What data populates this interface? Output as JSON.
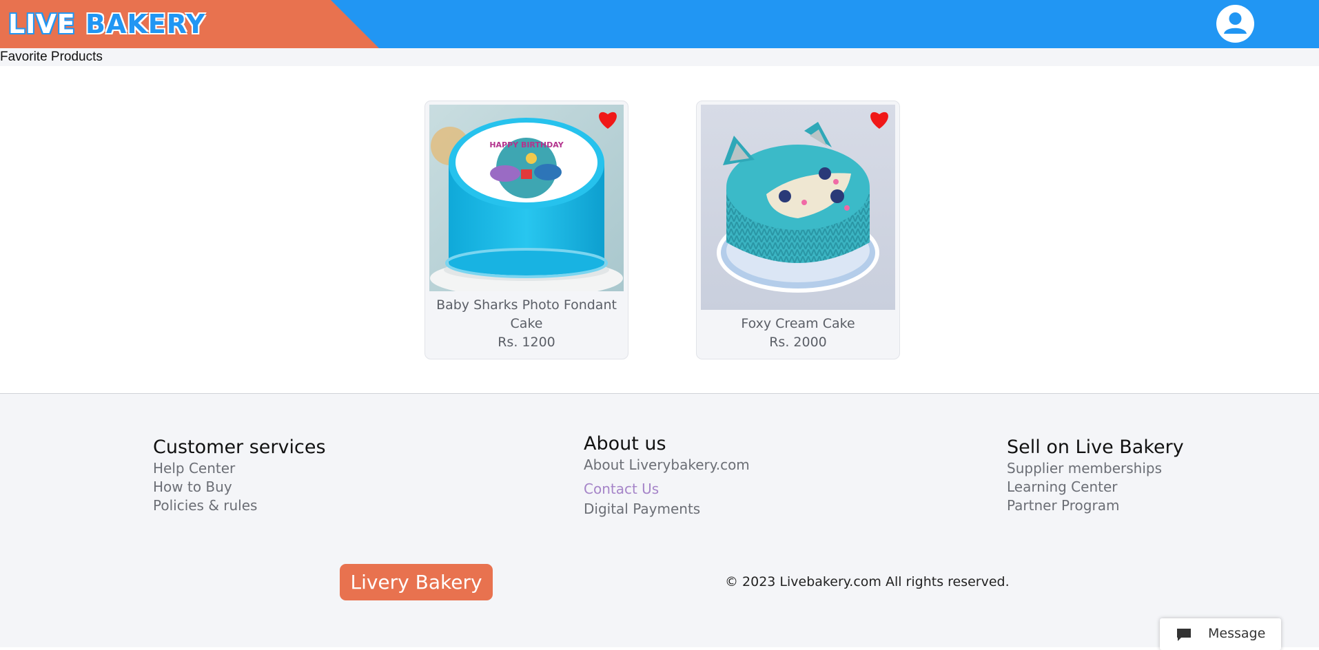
{
  "header": {
    "logo_word1": "LIVE",
    "logo_word2": "BAKERY",
    "colors": {
      "bar": "#2196f3",
      "brand": "#e8724f"
    }
  },
  "page": {
    "title": "Favorite Products"
  },
  "products": [
    {
      "name": "Baby Sharks Photo Fondant Cake",
      "price": "Rs. 1200",
      "favorite": true,
      "image": "blue fondant cake with baby shark photo"
    },
    {
      "name": "Foxy Cream Cake",
      "price": "Rs. 2000",
      "favorite": true,
      "image": "teal cream cake shaped like a fox"
    }
  ],
  "footer": {
    "columns": [
      {
        "heading": "Customer services",
        "links": [
          "Help Center",
          "How to Buy",
          "Policies & rules"
        ]
      },
      {
        "heading": "About us",
        "links": [
          "About Liverybakery.com",
          "Contact Us",
          "Digital Payments"
        ]
      },
      {
        "heading": "Sell on Live Bakery",
        "links": [
          "Supplier memberships",
          "Learning Center",
          "Partner Program"
        ]
      }
    ],
    "brand_button": "Livery Bakery",
    "copyright": "© 2023 Livebakery.com All rights reserved."
  },
  "chat": {
    "label": "Message",
    "icon": "chat-bubble-icon"
  }
}
